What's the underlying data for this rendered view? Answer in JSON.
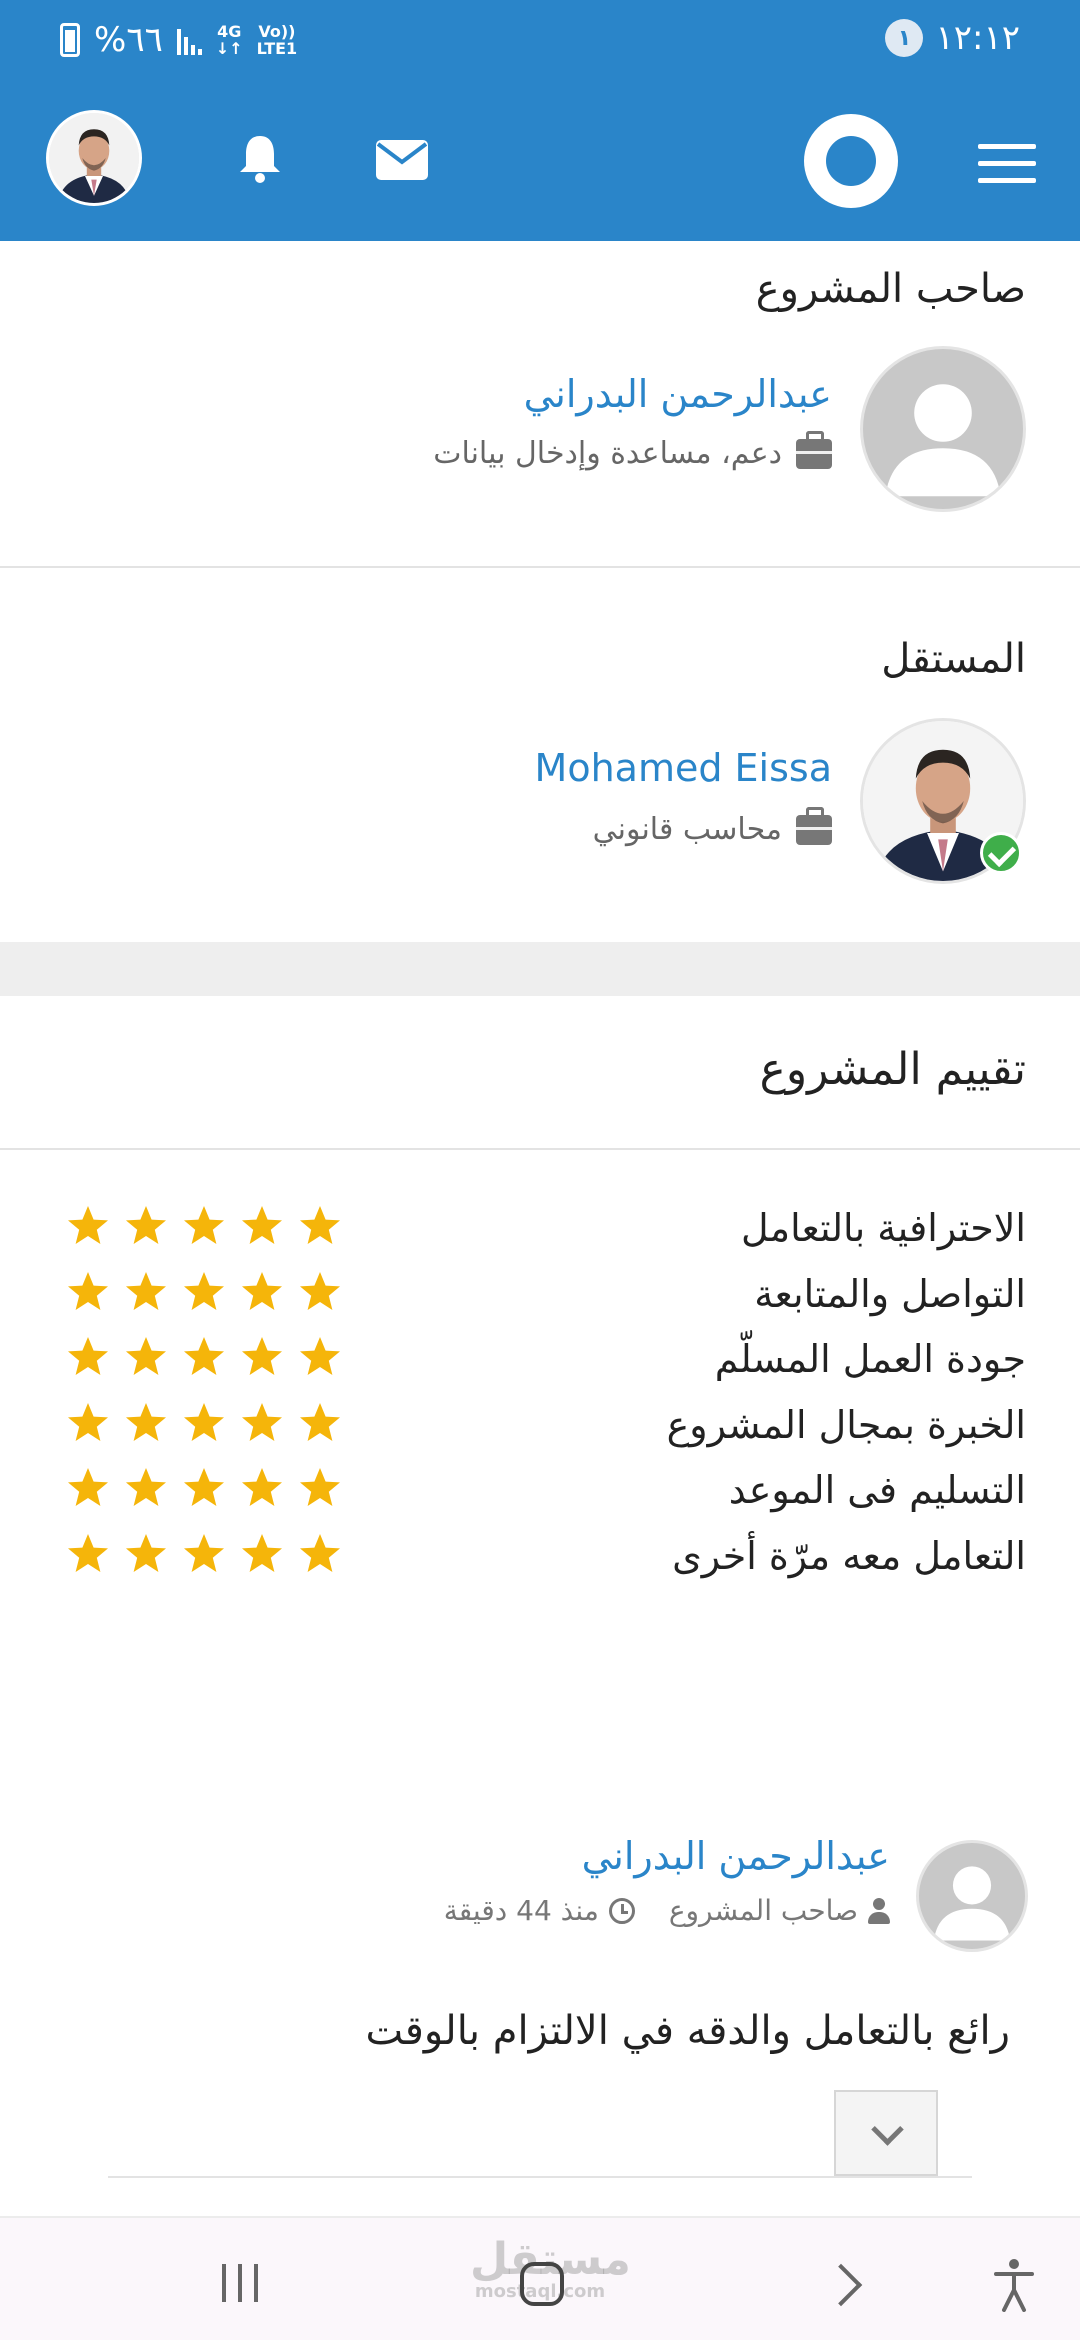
{
  "status_bar": {
    "battery_text": "%٦٦",
    "network_top": "4G",
    "network_bottom": "Vo))",
    "lte": "LTE1",
    "time": "١٢:١٢",
    "notification_count": "١"
  },
  "project_owner": {
    "section_title": "صاحب المشروع",
    "name": "عبدالرحمن البدراني",
    "role": "دعم، مساعدة وإدخال بيانات"
  },
  "freelancer": {
    "section_title": "المستقل",
    "name": "Mohamed Eissa",
    "role": "محاسب قانوني",
    "verified": true
  },
  "rating": {
    "section_title": "تقييم المشروع",
    "max_stars": 5,
    "star_color": "#f5b50a",
    "criteria": [
      {
        "label": "الاحترافية بالتعامل",
        "stars": 5
      },
      {
        "label": "التواصل والمتابعة",
        "stars": 5
      },
      {
        "label": "جودة العمل المسلّم",
        "stars": 5
      },
      {
        "label": "الخبرة بمجال المشروع",
        "stars": 5
      },
      {
        "label": "التسليم فى الموعد",
        "stars": 5
      },
      {
        "label": "التعامل معه مرّة أخرى",
        "stars": 5
      }
    ]
  },
  "review": {
    "author": "عبدالرحمن البدراني",
    "author_role": "صاحب المشروع",
    "time_ago": "منذ 44 دقيقة",
    "text": "رائع بالتعامل والدقه في الالتزام بالوقت"
  },
  "watermark": {
    "main": "مستقل",
    "sub": "mostaql.com"
  },
  "colors": {
    "brand_blue": "#2a85c9",
    "link_blue": "#2a85c9",
    "verified_green": "#3fae4a"
  },
  "icons": {
    "header": [
      "avatar",
      "bell-icon",
      "envelope-icon",
      "logo-ring",
      "hamburger-icon"
    ],
    "nav": [
      "recent-apps-icon",
      "home-icon",
      "back-icon",
      "accessibility-icon"
    ]
  }
}
